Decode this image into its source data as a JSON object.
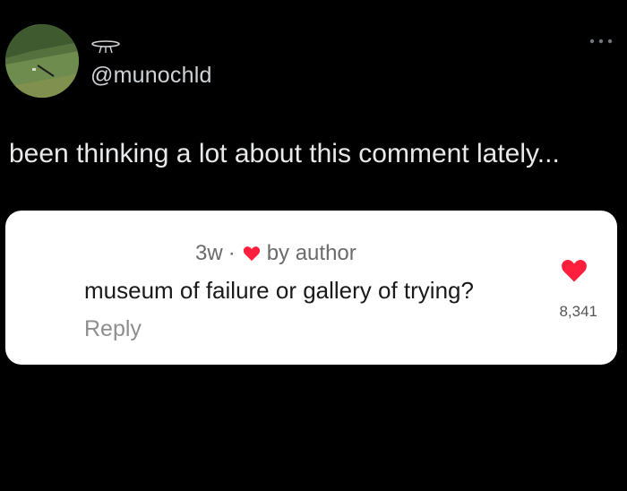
{
  "post": {
    "handle": "@munochld",
    "text": "been thinking a lot about this comment lately..."
  },
  "comment": {
    "age": "3w",
    "separator": "·",
    "liked_by": "by author",
    "text": "museum of failure or gallery of trying?",
    "reply_label": "Reply",
    "like_count": "8,341"
  },
  "colors": {
    "background": "#000000",
    "heart": "#ff1f3d",
    "card": "#ffffff"
  }
}
